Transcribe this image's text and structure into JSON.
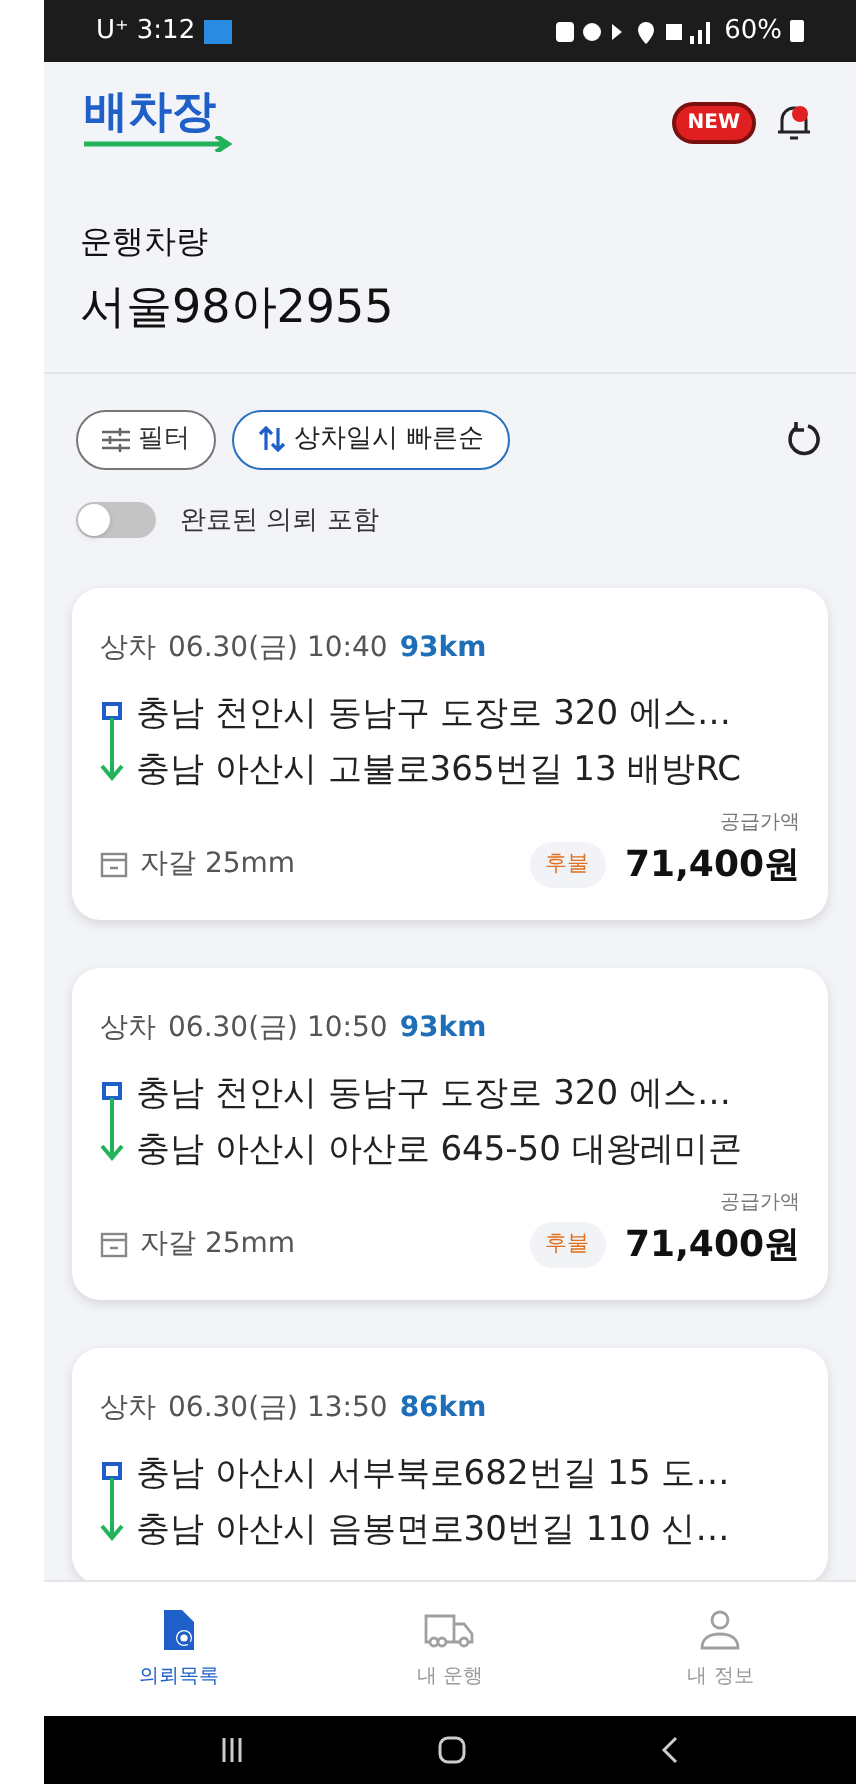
{
  "status_bar": {
    "carrier": "U⁺",
    "time": "3:12",
    "battery": "60%"
  },
  "header": {
    "logo": "배차장",
    "new_badge": "NEW"
  },
  "vehicle": {
    "label": "운행차량",
    "plate": "서울98아2955"
  },
  "toolbar": {
    "filter_button": "필터",
    "sort_button": "상차일시 빠른순"
  },
  "completed_toggle": {
    "label": "완료된 의뢰 포함",
    "on": false
  },
  "orders": [
    {
      "pickup_label": "상차",
      "datetime": "06.30(금) 10:40",
      "distance": "93km",
      "origin": "충남 천안시 동남구 도장로 320 에스…",
      "destination": "충남 아산시 고불로365번길 13 배방RC",
      "price_label": "공급가액",
      "cargo": "자갈 25mm",
      "payment": "후불",
      "price": "71,400원"
    },
    {
      "pickup_label": "상차",
      "datetime": "06.30(금) 10:50",
      "distance": "93km",
      "origin": "충남 천안시 동남구 도장로 320 에스…",
      "destination": "충남 아산시 아산로 645-50 대왕레미콘",
      "price_label": "공급가액",
      "cargo": "자갈 25mm",
      "payment": "후불",
      "price": "71,400원"
    },
    {
      "pickup_label": "상차",
      "datetime": "06.30(금) 13:50",
      "distance": "86km",
      "origin": "충남 아산시 서부북로682번길 15 도…",
      "destination": "충남 아산시 음봉면로30번길 110 신…"
    }
  ],
  "bottom_nav": [
    {
      "kind": "requests",
      "label": "의뢰목록",
      "selected": true
    },
    {
      "kind": "truck",
      "label": "내 운행",
      "selected": false
    },
    {
      "kind": "profile",
      "label": "내 정보",
      "selected": false
    }
  ]
}
